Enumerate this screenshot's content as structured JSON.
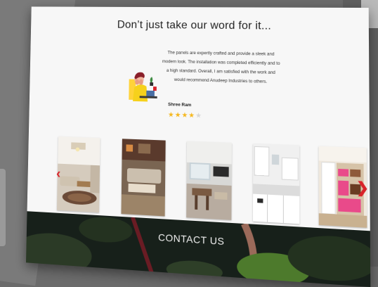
{
  "testimonials": {
    "title": "Don’t just take our word for it...",
    "quote": "The panels are expertly crafted and provide a sleek and modern look. The installation was completed efficiently and to a high standard. Overall, I am satisfied with the work and would recommend Anudeep Industries to others.",
    "author": "Shree Ram",
    "rating": 4,
    "rating_max": 5,
    "illustration_icon": "person-at-desk-illustration"
  },
  "gallery": {
    "photos": [
      {
        "icon": "interior-photo-living-room"
      },
      {
        "icon": "interior-photo-lounge"
      },
      {
        "icon": "interior-photo-office"
      },
      {
        "icon": "interior-photo-kitchen"
      },
      {
        "icon": "interior-photo-shelving"
      }
    ],
    "prev_icon": "chevron-left-icon",
    "next_icon": "chevron-right-icon",
    "arrow_color": "#d8232a"
  },
  "contact": {
    "label": "CONTACT US"
  },
  "colors": {
    "star": "#f5b820",
    "star_empty": "#d6d6d6",
    "accent": "#d8232a"
  }
}
